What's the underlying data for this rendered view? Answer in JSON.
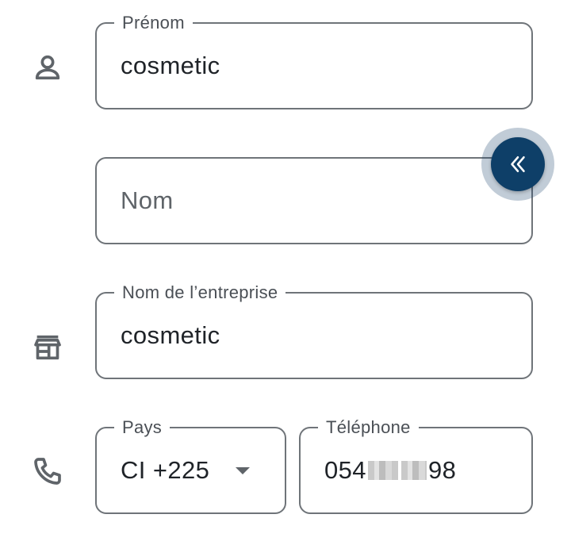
{
  "form": {
    "first_name": {
      "label": "Prénom",
      "value": "cosmetic"
    },
    "last_name": {
      "placeholder": "Nom"
    },
    "company": {
      "label": "Nom de l’entreprise",
      "value": "cosmetic"
    },
    "country": {
      "label": "Pays",
      "value": "CI +225"
    },
    "phone": {
      "label": "Téléphone",
      "value_start": "054",
      "value_end": "98"
    }
  },
  "icons": {
    "person": "person-icon",
    "store": "store-icon",
    "phone": "phone-icon",
    "collapse": "double-chevron-left-icon"
  },
  "colors": {
    "border": "#6f7479",
    "label": "#4a4f55",
    "text": "#1f2328",
    "fab": "#0e3f68"
  }
}
